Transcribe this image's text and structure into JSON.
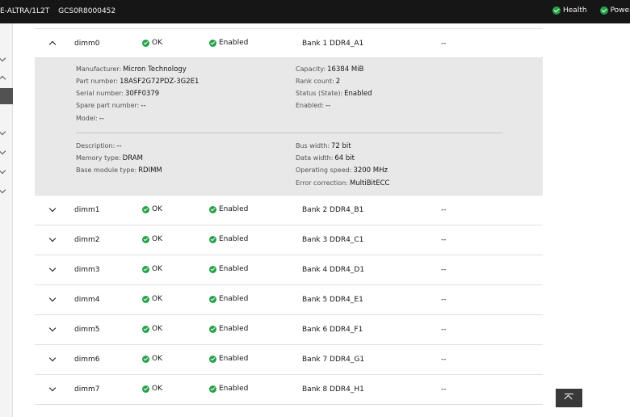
{
  "header": {
    "system_name": "E-ALTRA/1L2T",
    "serial": "GCS0R8000452",
    "health_label": "Health",
    "power_label": "Power"
  },
  "dimms": [
    {
      "name": "dimm0",
      "health": "OK",
      "state": "Enabled",
      "location": "Bank 1 DDR4_A1",
      "part": "--",
      "expanded": true
    },
    {
      "name": "dimm1",
      "health": "OK",
      "state": "Enabled",
      "location": "Bank 2 DDR4_B1",
      "part": "--"
    },
    {
      "name": "dimm2",
      "health": "OK",
      "state": "Enabled",
      "location": "Bank 3 DDR4_C1",
      "part": "--"
    },
    {
      "name": "dimm3",
      "health": "OK",
      "state": "Enabled",
      "location": "Bank 4 DDR4_D1",
      "part": "--"
    },
    {
      "name": "dimm4",
      "health": "OK",
      "state": "Enabled",
      "location": "Bank 5 DDR4_E1",
      "part": "--"
    },
    {
      "name": "dimm5",
      "health": "OK",
      "state": "Enabled",
      "location": "Bank 6 DDR4_F1",
      "part": "--"
    },
    {
      "name": "dimm6",
      "health": "OK",
      "state": "Enabled",
      "location": "Bank 7 DDR4_G1",
      "part": "--"
    },
    {
      "name": "dimm7",
      "health": "OK",
      "state": "Enabled",
      "location": "Bank 8 DDR4_H1",
      "part": "--"
    }
  ],
  "details": {
    "manufacturer": {
      "label": "Manufacturer:",
      "value": "Micron Technology"
    },
    "part_number": {
      "label": "Part number:",
      "value": "18ASF2G72PDZ-3G2E1"
    },
    "serial_number": {
      "label": "Serial number:",
      "value": "30FF0379"
    },
    "spare_part_number": {
      "label": "Spare part number:",
      "value": "--"
    },
    "model": {
      "label": "Model:",
      "value": "--"
    },
    "capacity": {
      "label": "Capacity:",
      "value": "16384 MiB"
    },
    "rank_count": {
      "label": "Rank count:",
      "value": "2"
    },
    "status_state": {
      "label": "Status (State):",
      "value": "Enabled"
    },
    "enabled": {
      "label": "Enabled:",
      "value": "--"
    },
    "description": {
      "label": "Description:",
      "value": "--"
    },
    "memory_type": {
      "label": "Memory type:",
      "value": "DRAM"
    },
    "base_module_type": {
      "label": "Base module type:",
      "value": "RDIMM"
    },
    "bus_width": {
      "label": "Bus width:",
      "value": "72 bit"
    },
    "data_width": {
      "label": "Data width:",
      "value": "64 bit"
    },
    "operating_speed": {
      "label": "Operating speed:",
      "value": "3200 MHz"
    },
    "error_correction": {
      "label": "Error correction:",
      "value": "MultiBitECC"
    }
  },
  "colors": {
    "header_bg": "#161616",
    "ok_green": "#24a148",
    "details_bg": "#e8e8e8"
  }
}
